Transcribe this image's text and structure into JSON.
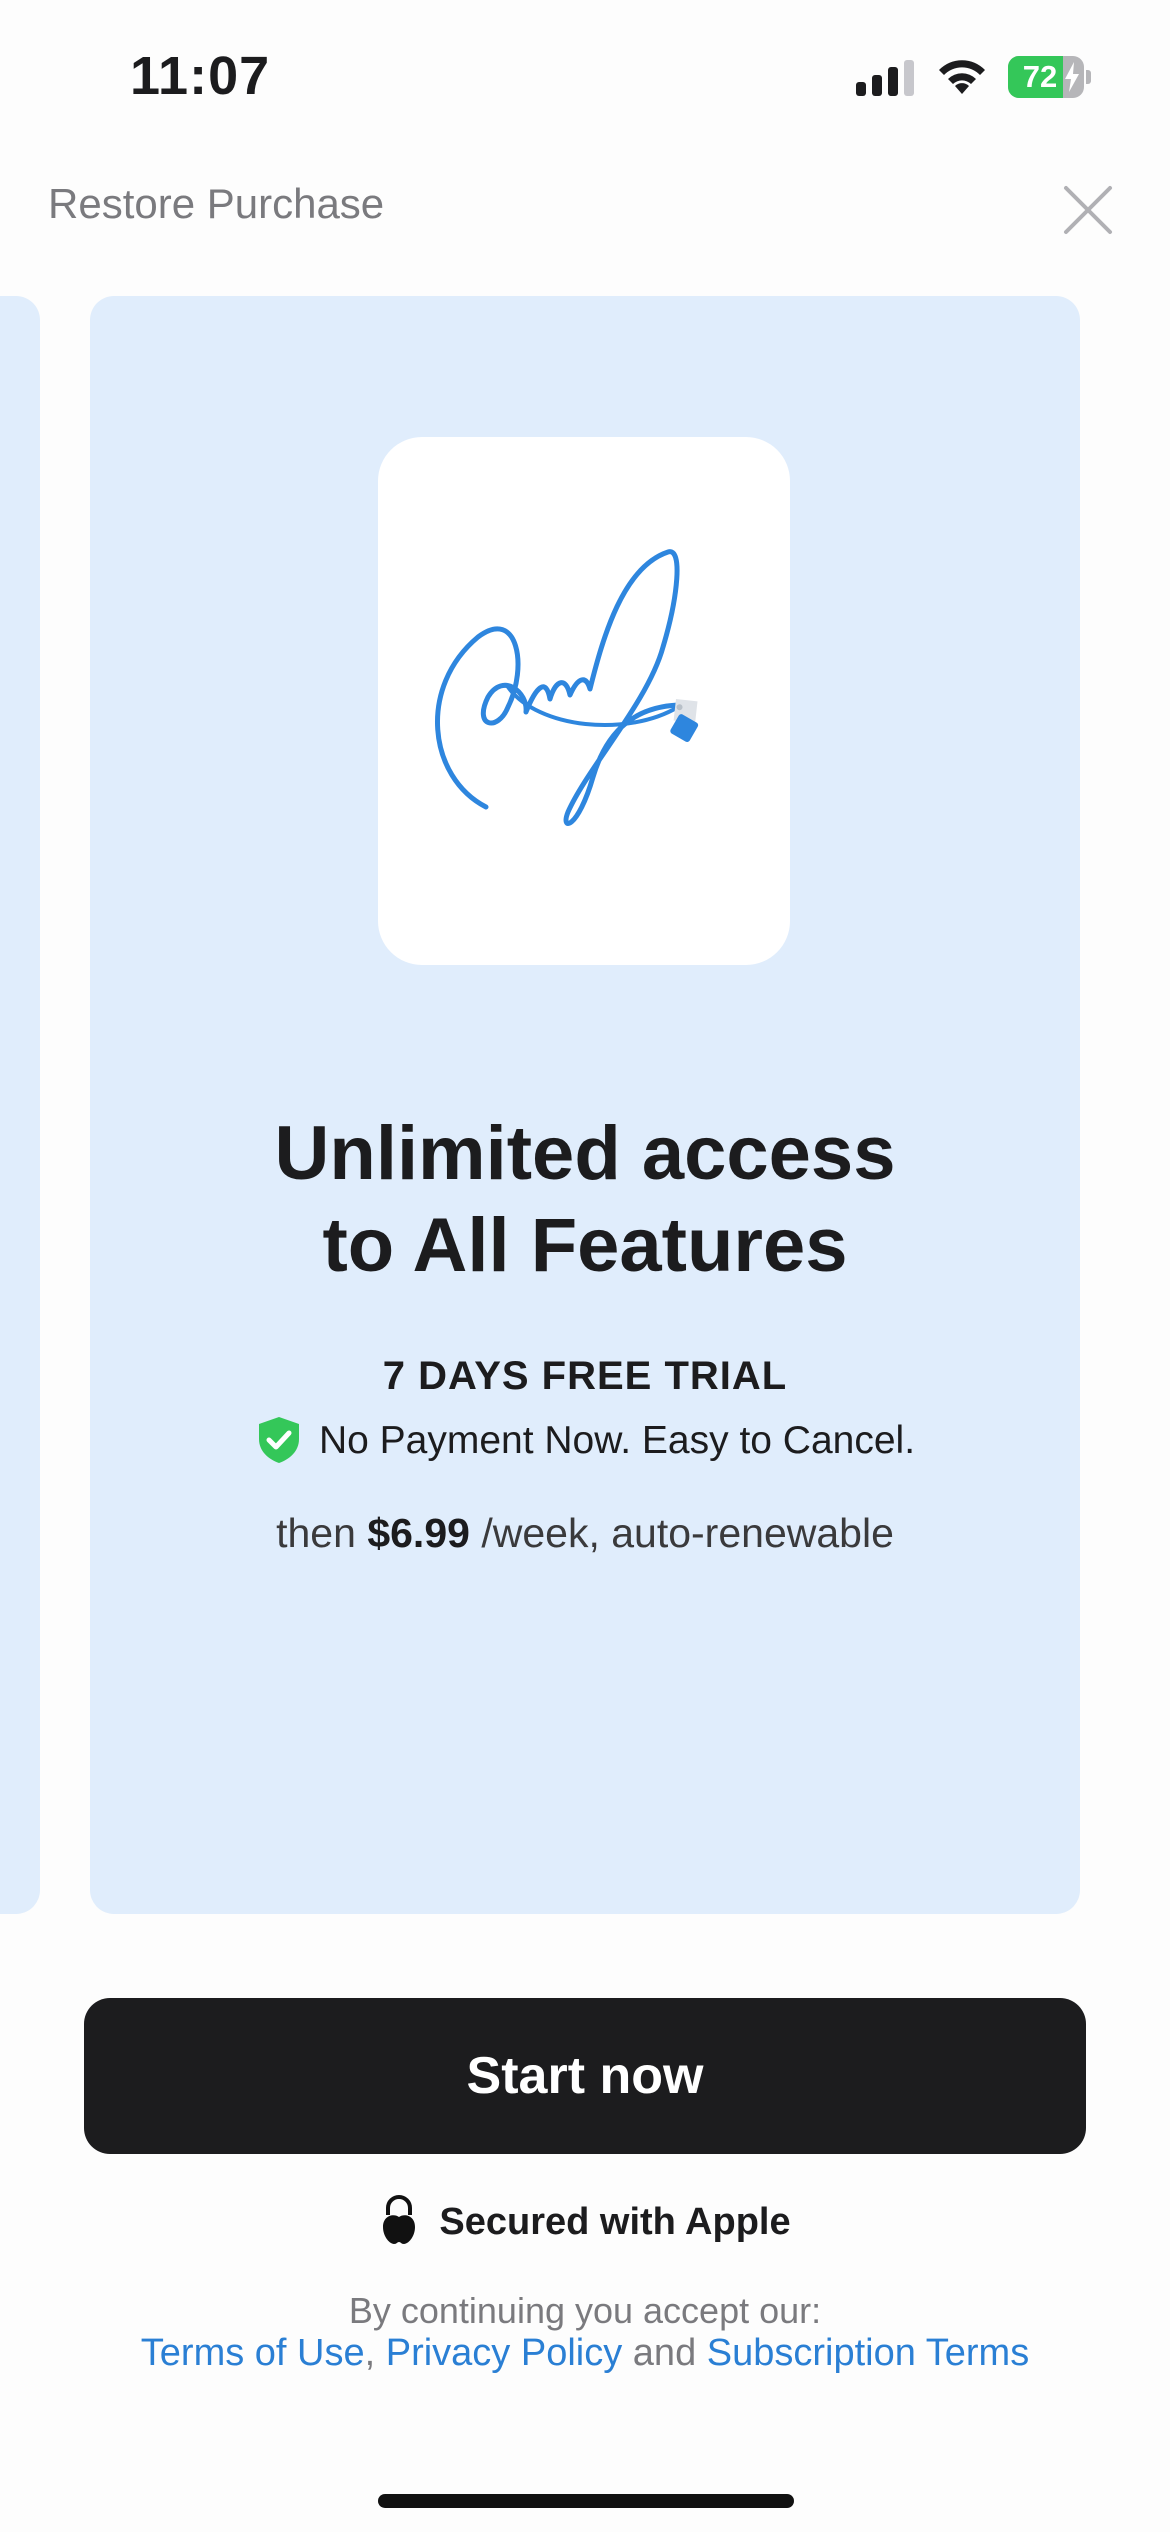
{
  "status_bar": {
    "time": "11:07",
    "battery_level": 72,
    "battery_text": "72",
    "battery_color": "#34c759",
    "icons": [
      "signal-icon",
      "wifi-icon",
      "battery-icon",
      "charging-bolt-icon"
    ]
  },
  "header": {
    "restore_label": "Restore Purchase",
    "close_icon": "close-icon"
  },
  "card": {
    "illustration": "signature-icon",
    "headline_line1": "Unlimited access",
    "headline_line2": "to All Features",
    "trial_label": "7 DAYS FREE TRIAL",
    "no_payment_text": "No Payment Now. Easy to Cancel.",
    "price_prefix": "then",
    "price_amount": "$6.99",
    "price_suffix": "/week, auto-renewable",
    "background_color": "#e0edfc"
  },
  "cta": {
    "start_label": "Start now",
    "secured_text": "Secured with Apple"
  },
  "legal": {
    "intro": "By continuing you accept our:",
    "terms_label": "Terms of Use",
    "comma": ",",
    "privacy_label": "Privacy Policy",
    "and_text": "and",
    "subscription_label": "Subscription Terms",
    "link_color": "#2a7fd4"
  }
}
